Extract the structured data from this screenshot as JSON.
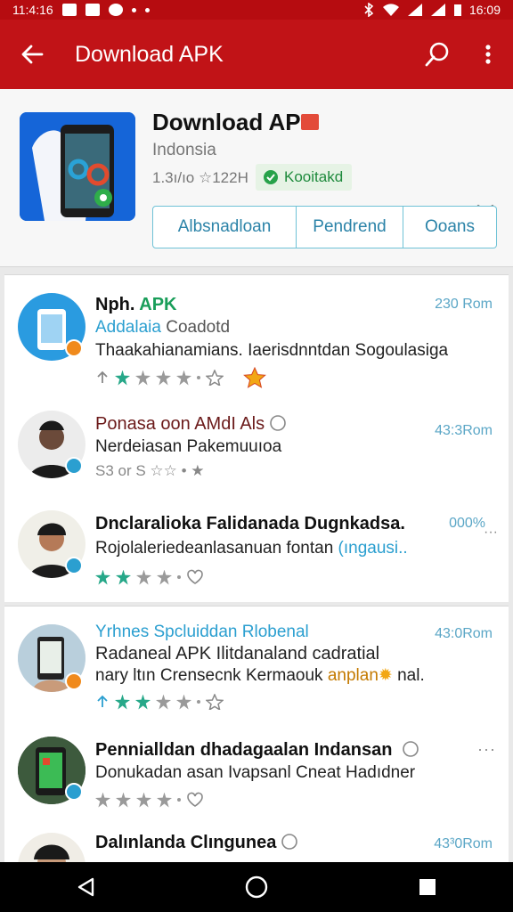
{
  "status_bar": {
    "time_left": "11:4:16",
    "time_right": "16:09"
  },
  "app_bar": {
    "title": "Download APK",
    "back_icon": "arrow-back-icon",
    "search_icon": "search-icon",
    "menu_icon": "more-vert-icon"
  },
  "top_card": {
    "title": "Download AP",
    "subtitle": "Indonsia",
    "meta": "1.3ı/ıo ☆122H",
    "verified": "Kooitakd",
    "buttons": [
      "Albsnadloan",
      "Pendrend",
      "Ooans"
    ]
  },
  "list": [
    {
      "title": "Nph.",
      "title_accent": "APK",
      "sub_accent": "Addalaia",
      "sub_accent_rest": " Coadotd",
      "line": "Thaakahianamians. Iaerisdnntdan Sogoulasiga",
      "time": "230 Rom",
      "stars": [
        1,
        1,
        0,
        0,
        0
      ],
      "extra": "gold"
    },
    {
      "title": "Ponasa oon AMdI Als",
      "line": "Nerdeiasan Pakemuuıoa",
      "meta": "S3 or S ☆☆ • ★",
      "time": "43:3Rom"
    },
    {
      "title": "Dnclaralioka Falidanada Dugnkadsa.",
      "line": "Rojolaleriedeanlasanuan fontan",
      "line_accent": " (ıngausi..",
      "time": "000%",
      "stars": [
        1,
        1,
        0,
        0,
        0
      ]
    },
    {
      "title": "Yrhnes Spcluiddan Rlobenal",
      "line": "Radaneal APK Ilitdanaland cadratial",
      "line2": "nary ltın Crensecnk Kermaouk ",
      "line2_accent": "anplan",
      "line2_end": " nal.",
      "time": "43:0Rom",
      "stars": [
        1,
        1,
        0,
        0,
        0
      ]
    },
    {
      "title": "Pennialldan dhadagaalan Indansan",
      "line": "Donukadan asan Ivapsanl Cneat Hadıdner",
      "time": "",
      "stars": [
        0,
        0,
        0,
        0,
        0
      ]
    },
    {
      "title": "Dalınlanda Clıngunea",
      "time": "43³0Rom"
    }
  ],
  "colors": {
    "primary": "#c11317",
    "accent": "#2b9fd0",
    "verified": "#1e8a3c",
    "star": "#27a889"
  }
}
